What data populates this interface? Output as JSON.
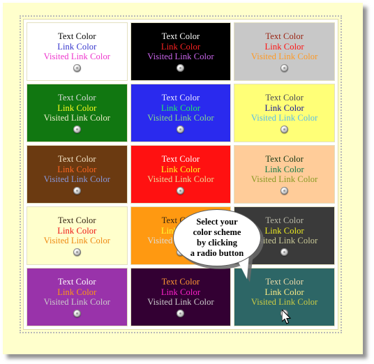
{
  "page": {
    "background_color": "#ffffcc",
    "frame_border_color": "#b9b9b9"
  },
  "labels": {
    "text_color": "Text Color",
    "link_color": "Link Color",
    "visited_link_color": "Visited Link Color",
    "radio_icon": "radio-button-icon",
    "cursor_icon": "mouse-pointer-icon"
  },
  "callout": {
    "lines": [
      "Select your",
      "color scheme",
      "by clicking",
      "a radio button"
    ],
    "background_color": "#ffffff",
    "border_color": "#5a5a5a",
    "shadow_color": "#6b6b6b"
  },
  "swatches": [
    {
      "id": "scheme-1",
      "bg": "#ffffff",
      "text": "#000000",
      "link": "#3333cc",
      "visited": "#ee33cc",
      "selected": false
    },
    {
      "id": "scheme-2",
      "bg": "#000000",
      "text": "#ffffff",
      "link": "#ff2222",
      "visited": "#cc66ee",
      "selected": false
    },
    {
      "id": "scheme-3",
      "bg": "#c8c8c8",
      "text": "#992211",
      "link": "#ff1111",
      "visited": "#ff9922",
      "selected": false
    },
    {
      "id": "scheme-4",
      "bg": "#117711",
      "text": "#dddddd",
      "link": "#ffff22",
      "visited": "#eeeecc",
      "selected": false
    },
    {
      "id": "scheme-5",
      "bg": "#2a2aee",
      "text": "#eeeeff",
      "link": "#22ee66",
      "visited": "#88dd88",
      "selected": false
    },
    {
      "id": "scheme-6",
      "bg": "#ffff77",
      "text": "#444455",
      "link": "#111199",
      "visited": "#55bbee",
      "selected": false
    },
    {
      "id": "scheme-7",
      "bg": "#6b3a11",
      "text": "#f5e6c8",
      "link": "#ff6622",
      "visited": "#8899dd",
      "selected": false
    },
    {
      "id": "scheme-8",
      "bg": "#ff1111",
      "text": "#ffffff",
      "link": "#ffff22",
      "visited": "#eedd99",
      "selected": false
    },
    {
      "id": "scheme-9",
      "bg": "#ffcc99",
      "text": "#113311",
      "link": "#117744",
      "visited": "#889922",
      "selected": false
    },
    {
      "id": "scheme-10",
      "bg": "#ffffcc",
      "text": "#332211",
      "link": "#ee1111",
      "visited": "#ee8811",
      "selected": false
    },
    {
      "id": "scheme-11",
      "bg": "#ff9911",
      "text": "#332211",
      "link": "#ffff33",
      "visited": "#dddddd",
      "selected": false
    },
    {
      "id": "scheme-12",
      "bg": "#3a3a3a",
      "text": "#bbbbaa",
      "link": "#eeee22",
      "visited": "#cccc99",
      "selected": false
    },
    {
      "id": "scheme-13",
      "bg": "#9933aa",
      "text": "#ffffff",
      "link": "#ff9911",
      "visited": "#cccccc",
      "selected": false
    },
    {
      "id": "scheme-14",
      "bg": "#330033",
      "text": "#ff9933",
      "link": "#ff22cc",
      "visited": "#cccccc",
      "selected": false
    },
    {
      "id": "scheme-15",
      "bg": "#2d6666",
      "text": "#eedcaa",
      "link": "#ffee88",
      "visited": "#cccc44",
      "selected": false
    }
  ]
}
